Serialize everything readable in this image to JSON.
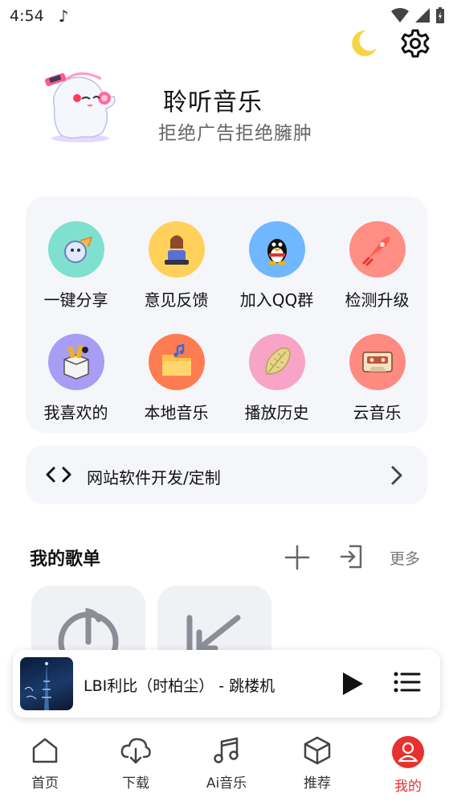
{
  "status": {
    "time": "4:54",
    "note_icon": "music-note-icon"
  },
  "header": {
    "theme_icon": "moon-icon",
    "settings_icon": "gear-icon"
  },
  "profile": {
    "title": "聆听音乐",
    "slogan": "拒绝广告拒绝臃肿"
  },
  "grid": {
    "items": [
      {
        "label": "一键分享",
        "icon": "share-icon",
        "color": "#7fe0cf"
      },
      {
        "label": "意见反馈",
        "icon": "feedback-icon",
        "color": "#ffd15a"
      },
      {
        "label": "加入QQ群",
        "icon": "qq-penguin-icon",
        "color": "#6fb8ff"
      },
      {
        "label": "检测升级",
        "icon": "rocket-icon",
        "color": "#ff8e84"
      },
      {
        "label": "我喜欢的",
        "icon": "favorites-box-icon",
        "color": "#a99cf5"
      },
      {
        "label": "本地音乐",
        "icon": "folder-music-icon",
        "color": "#ff7c52"
      },
      {
        "label": "播放历史",
        "icon": "history-leaf-icon",
        "color": "#f8a4c6"
      },
      {
        "label": "云音乐",
        "icon": "cassette-icon",
        "color": "#ff8a80"
      }
    ]
  },
  "dev": {
    "label": "网站软件开发/定制"
  },
  "playlists": {
    "title": "我的歌单",
    "more": "更多"
  },
  "player": {
    "track": "LBI利比（时柏尘） - 跳楼机"
  },
  "nav": {
    "items": [
      {
        "label": "首页"
      },
      {
        "label": "下载"
      },
      {
        "label": "Ai音乐"
      },
      {
        "label": "推荐"
      },
      {
        "label": "我的"
      }
    ],
    "active_color": "#e8302f"
  }
}
